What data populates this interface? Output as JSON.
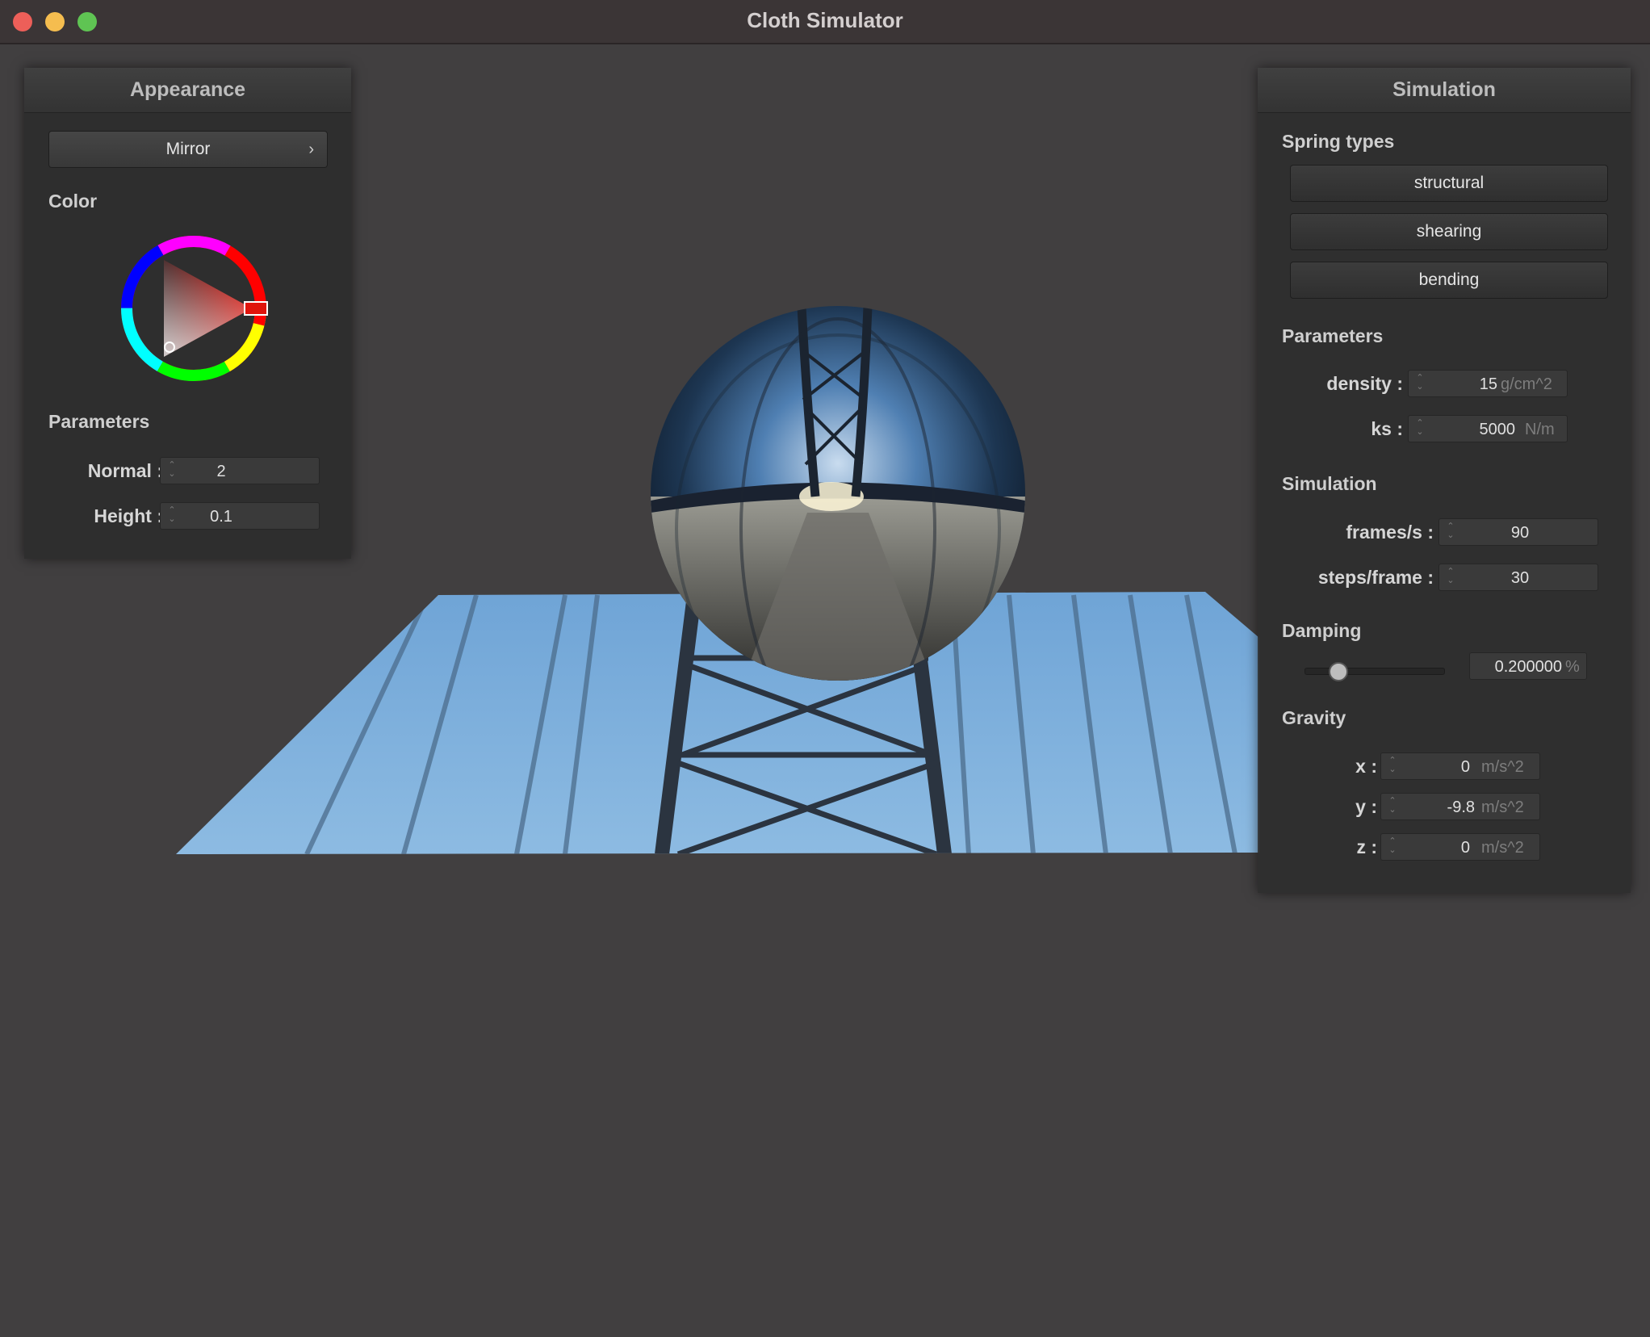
{
  "window": {
    "title": "Cloth Simulator"
  },
  "appearance": {
    "header": "Appearance",
    "shader_dropdown": {
      "selected": "Mirror"
    },
    "color_label": "Color",
    "color": "#e0140c",
    "parameters_label": "Parameters",
    "normal": {
      "label": "Normal :",
      "value": "2"
    },
    "height": {
      "label": "Height :",
      "value": "0.1"
    }
  },
  "simulation": {
    "header": "Simulation",
    "spring_types_label": "Spring types",
    "spring_buttons": [
      "structural",
      "shearing",
      "bending"
    ],
    "parameters_label": "Parameters",
    "density": {
      "label": "density :",
      "value": "15",
      "unit": "g/cm^2"
    },
    "ks": {
      "label": "ks :",
      "value": "5000",
      "unit": "N/m"
    },
    "simulation_label": "Simulation",
    "frames_per_s": {
      "label": "frames/s :",
      "value": "90"
    },
    "steps_per_frame": {
      "label": "steps/frame :",
      "value": "30"
    },
    "damping_label": "Damping",
    "damping": {
      "value": "0.200000",
      "unit": "%",
      "slider_fraction": 0.2
    },
    "gravity_label": "Gravity",
    "gravity_x": {
      "label": "x :",
      "value": "0",
      "unit": "m/s^2"
    },
    "gravity_y": {
      "label": "y :",
      "value": "-9.8",
      "unit": "m/s^2"
    },
    "gravity_z": {
      "label": "z :",
      "value": "0",
      "unit": "m/s^2"
    }
  },
  "scene": {
    "sky_color": "#7fb0dc",
    "background": "#413f40"
  }
}
